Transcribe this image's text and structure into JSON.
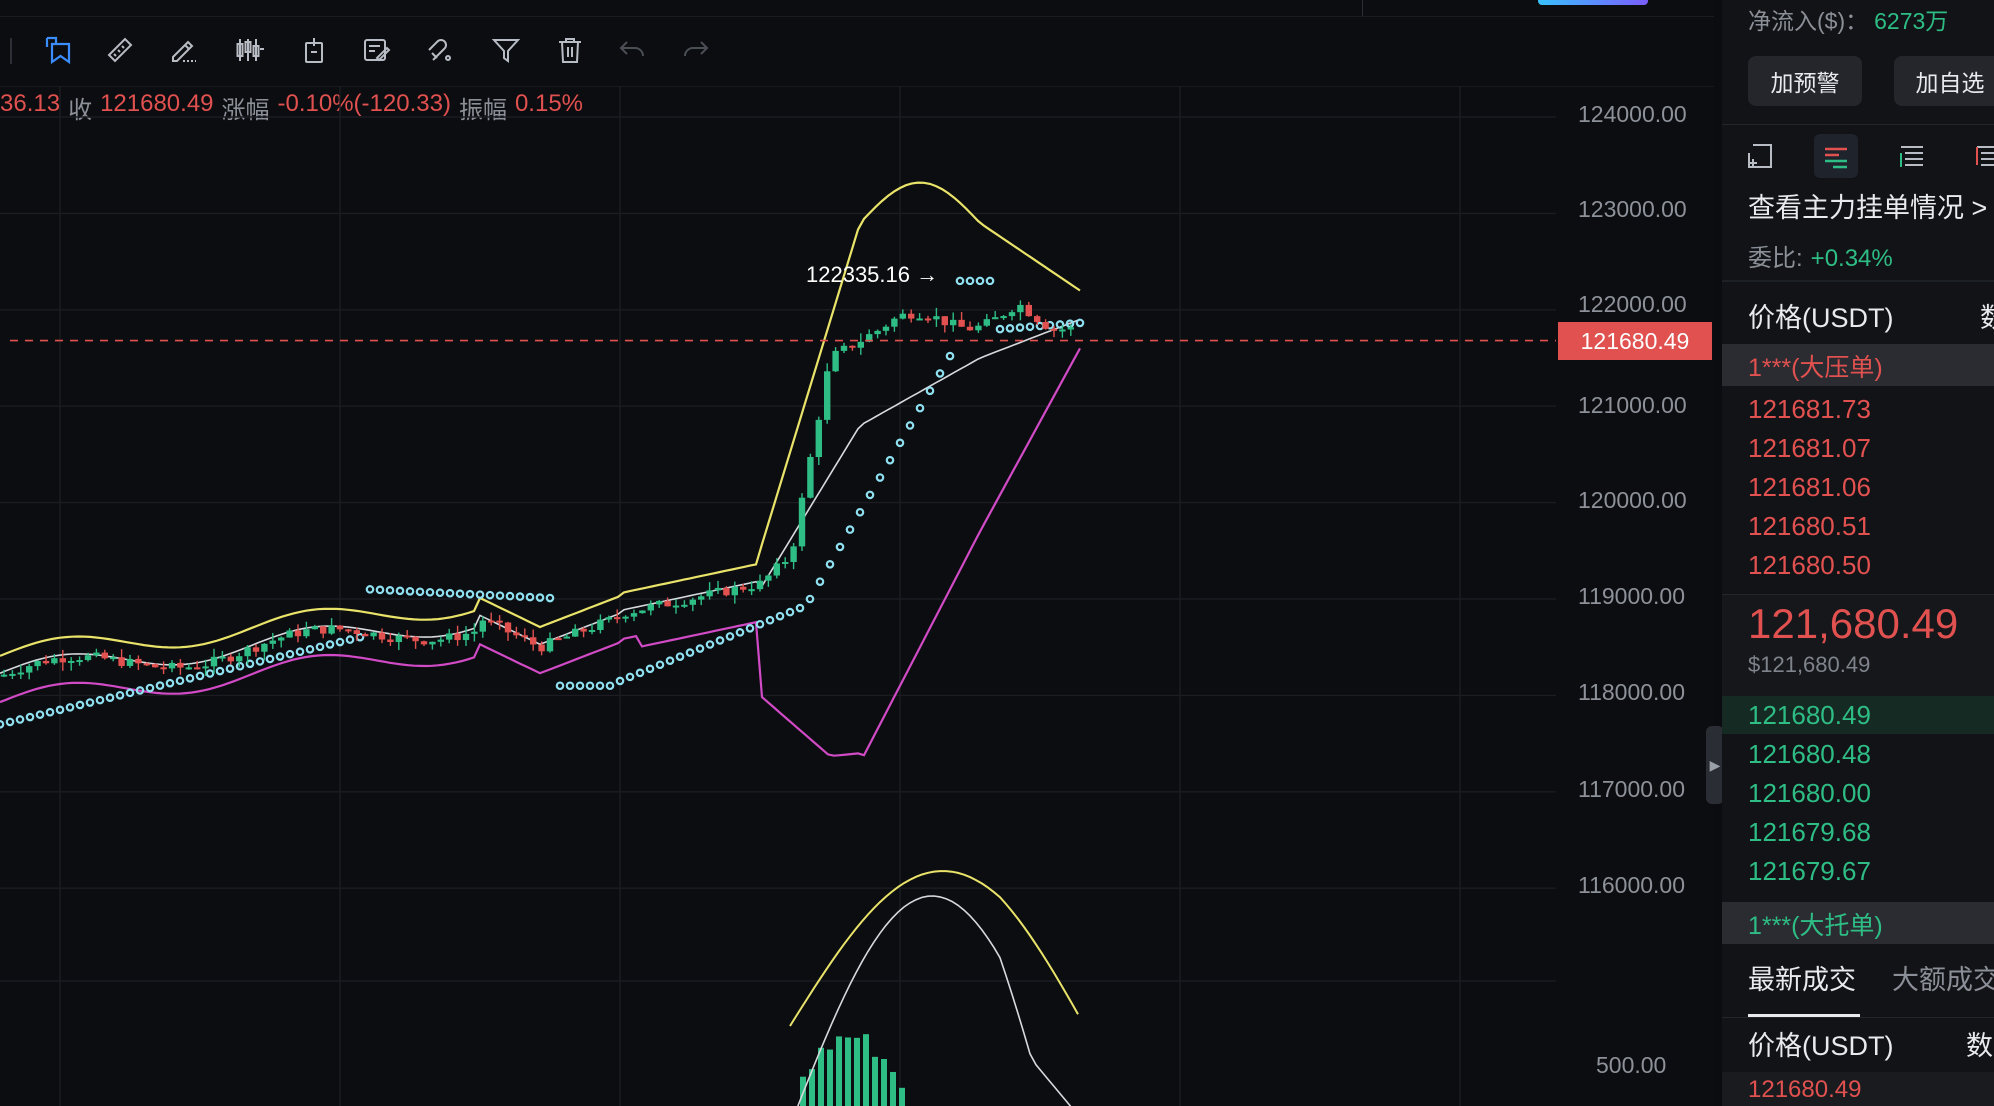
{
  "toolbar": {
    "tools": [
      "selection-tool",
      "ruler-tool",
      "brush-tool",
      "candle-compare-tool",
      "ruler-vertical-tool",
      "note-tool",
      "eraser-shape-tool",
      "filter-tool",
      "delete-tool",
      "undo-tool",
      "redo-tool"
    ]
  },
  "ohlc": {
    "open_partial": "36.13",
    "close_label": "收",
    "close_value": "121680.49",
    "change_label": "涨幅",
    "change_value": "-0.10%(-120.33)",
    "amplitude_label": "振幅",
    "amplitude_value": "0.15%"
  },
  "price_axis": {
    "labels": [
      "124000.00",
      "123000.00",
      "122000.00",
      "121000.00",
      "120000.00",
      "119000.00",
      "118000.00",
      "117000.00",
      "116000.00"
    ],
    "current_price": "121680.49",
    "sub_label": "500.00"
  },
  "chart_annotation": {
    "peak_label": "122335.16 →"
  },
  "chart_data": {
    "type": "candlestick",
    "y_range": [
      115500,
      124200
    ],
    "current_price": 121680.49,
    "peak_price": 122335.16,
    "indicators": [
      "bollinger_upper",
      "bollinger_mid",
      "bollinger_lower",
      "parabolic_sar",
      "volume_sub_chart"
    ],
    "colors": {
      "up": "#2ebd85",
      "down": "#e0514f",
      "upper": "#e9e36a",
      "mid": "#d6d9de",
      "lower": "#d14ac6",
      "sar": "#8fe0f0"
    }
  },
  "right_panel": {
    "net_inflow_label": "净流入($)：",
    "net_inflow_value": "6273万",
    "alert_button": "加预警",
    "watchlist_button": "加自选",
    "main_orders_link": "查看主力挂单情况 >",
    "ratio_label": "委比:",
    "ratio_value": "+0.34%",
    "price_col": "价格(USDT)",
    "qty_col": "数",
    "ask_big_label": "1***(大压单)",
    "asks": [
      "121681.73",
      "121681.07",
      "121681.06",
      "121680.51",
      "121680.50"
    ],
    "mid_price": "121,680.49",
    "mid_usd": "$121,680.49",
    "bids": [
      "121680.49",
      "121680.48",
      "121680.00",
      "121679.68",
      "121679.67"
    ],
    "bid_big_label": "1***(大托单)",
    "trades_tab_latest": "最新成交",
    "trades_tab_big": "大额成交",
    "trades_price_col": "价格(USDT)",
    "trades_qty_col": "数",
    "trade_first_price": "121680.49"
  },
  "colors": {
    "accent": "#3b8cff",
    "up": "#2ebd85",
    "down": "#e0514f"
  }
}
